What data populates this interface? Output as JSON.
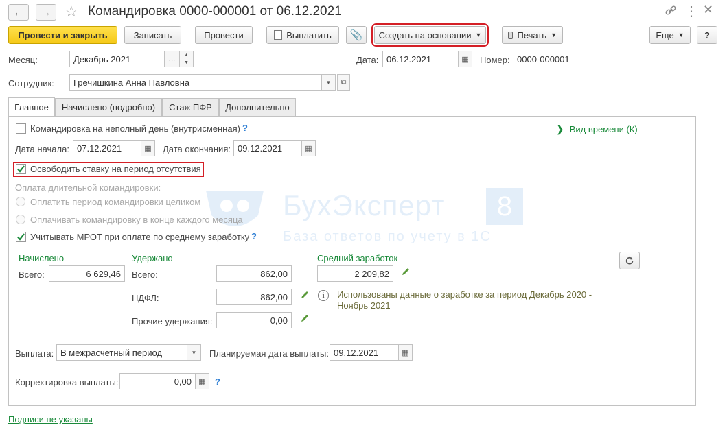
{
  "window": {
    "title": "Командировка 0000-000001 от 06.12.2021"
  },
  "toolbar": {
    "post_close": "Провести и закрыть",
    "save": "Записать",
    "post": "Провести",
    "pay": "Выплатить",
    "create_based": "Создать на основании",
    "print": "Печать",
    "more": "Еще",
    "help": "?"
  },
  "header": {
    "month_label": "Месяц:",
    "month_value": "Декабрь 2021",
    "date_label": "Дата:",
    "date_value": "06.12.2021",
    "number_label": "Номер:",
    "number_value": "0000-000001",
    "employee_label": "Сотрудник:",
    "employee_value": "Гречишкина Анна Павловна"
  },
  "tabs": [
    {
      "label": "Главное"
    },
    {
      "label": "Начислено (подробно)"
    },
    {
      "label": "Стаж ПФР"
    },
    {
      "label": "Дополнительно"
    }
  ],
  "main": {
    "partial_day_label": "Командировка на неполный день (внутрисменная)",
    "partial_day_help": "?",
    "time_kind_link": "Вид времени (К)",
    "start_label": "Дата начала:",
    "start_value": "07.12.2021",
    "end_label": "Дата окончания:",
    "end_value": "09.12.2021",
    "release_rate_label": "Освободить ставку на период отсутствия",
    "long_trip_label": "Оплата длительной командировки:",
    "pay_whole_label": "Оплатить период командировки целиком",
    "pay_monthly_label": "Оплачивать командировку в конце каждого месяца",
    "mrot_label": "Учитывать МРОТ при оплате по среднему заработку",
    "mrot_help": "?"
  },
  "totals": {
    "accrued_head": "Начислено",
    "accrued_total_label": "Всего:",
    "accrued_total_value": "6 629,46",
    "withheld_head": "Удержано",
    "withheld_total_label": "Всего:",
    "withheld_total_value": "862,00",
    "ndfl_label": "НДФЛ:",
    "ndfl_value": "862,00",
    "other_label": "Прочие удержания:",
    "other_value": "0,00",
    "avg_head": "Средний заработок",
    "avg_value": "2 209,82",
    "info_text": "Использованы данные о заработке за период Декабрь 2020 - Ноябрь 2021"
  },
  "payment": {
    "payout_label": "Выплата:",
    "payout_value": "В межрасчетный период",
    "planned_label": "Планируемая дата выплаты:",
    "planned_value": "09.12.2021",
    "correction_label": "Корректировка выплаты:",
    "correction_value": "0,00",
    "correction_help": "?"
  },
  "footer": {
    "signatures_link": "Подписи не указаны"
  },
  "watermark": {
    "brand": "БухЭксперт",
    "brand_num": "8",
    "tagline": "База ответов по учету в 1С"
  },
  "colors": {
    "accent_yellow": "#f5c918",
    "highlight_red": "#d41f26",
    "link_green": "#1a8a3a",
    "help_blue": "#2f7fd4"
  }
}
